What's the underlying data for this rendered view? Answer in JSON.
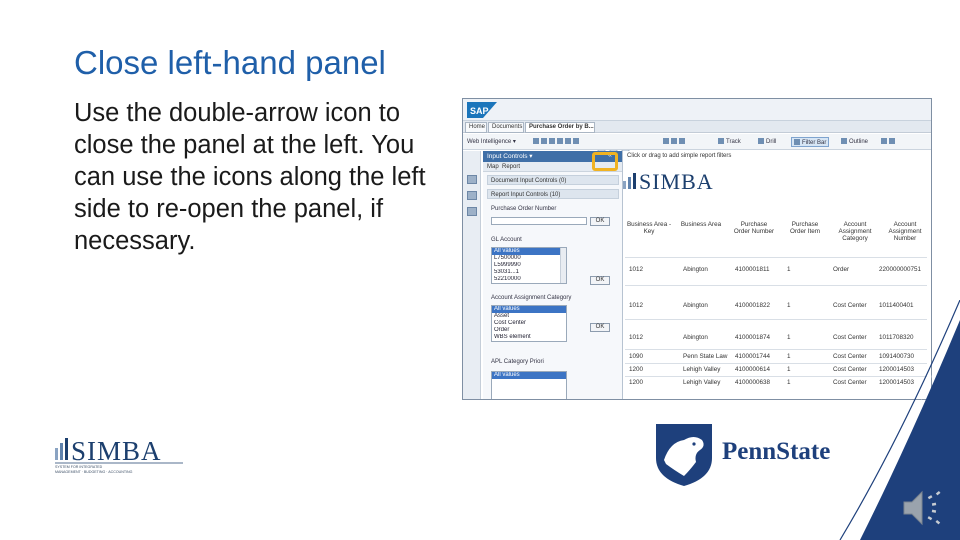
{
  "slide": {
    "title": "Close left-hand panel",
    "body": "Use the double-arrow icon to close the panel at the left. You can use the icons along the left side to re-open the panel, if necessary."
  },
  "screenshot": {
    "tabs": [
      "Home",
      "Documents",
      "Purchase Order by B..."
    ],
    "toolbar": {
      "left_label": "Web Intelligence",
      "track_label": "Track",
      "drill_label": "Drill",
      "filter_bar_label": "Filter Bar",
      "outline_label": "Outline"
    },
    "panel": {
      "header": "Input Controls",
      "map_label": "Map",
      "report_label": "Report",
      "doc_section": "Document Input Controls (0)",
      "report_section": "Report Input Controls (10)",
      "controls": [
        {
          "label": "Purchase Order Number",
          "type": "input",
          "ok": "OK"
        },
        {
          "label": "GL Account",
          "type": "list",
          "ok": "OK",
          "items": [
            "All values",
            "L7500000",
            "L5999990",
            "53031...1",
            "52210000"
          ]
        },
        {
          "label": "Account Assignment Category",
          "type": "list",
          "ok": "OK",
          "items": [
            "All values",
            "Asset",
            "Cost Center",
            "Order",
            "WBS element"
          ]
        },
        {
          "label": "APL Category Priori",
          "type": "list",
          "items": [
            "All values"
          ]
        }
      ],
      "collapse_glyph": "«"
    },
    "report": {
      "tip": "Click or drag to add simple report filters",
      "brand": "SIMBA",
      "headers": [
        "Business Area - Key",
        "Business Area",
        "Purchase Order Number",
        "Purchase Order Item",
        "Account Assignment Category",
        "Account Assignment Number"
      ],
      "rows": [
        [
          "1012",
          "Abington",
          "4100001811",
          "1",
          "Order",
          "220000000751"
        ],
        [
          "1012",
          "Abington",
          "4100001822",
          "1",
          "Cost Center",
          "1011400401"
        ],
        [
          "1012",
          "Abington",
          "4100001874",
          "1",
          "Cost Center",
          "1011708320"
        ],
        [
          "1090",
          "Penn State Law",
          "4100001744",
          "1",
          "Cost Center",
          "1091400730"
        ],
        [
          "1200",
          "Lehigh Valley",
          "4100000614",
          "1",
          "Cost Center",
          "1200014503"
        ],
        [
          "1200",
          "Lehigh Valley",
          "4100000638",
          "1",
          "Cost Center",
          "1200014503"
        ]
      ]
    }
  },
  "footer": {
    "simba_logo": "SIMBA",
    "simba_tagline_1": "SYSTEM FOR INTEGRATED",
    "simba_tagline_2": "MANAGEMENT · BUDGETING · ACCOUNTING",
    "psu_logo": "PennState"
  },
  "colors": {
    "title": "#1f5fa9",
    "simba_blue": "#1c3f6e",
    "psu_navy": "#1e407c",
    "highlight": "#f0b323",
    "panel_header": "#3f6fa7"
  },
  "icons": {
    "collapse": "double-arrow-left-icon",
    "speaker": "speaker-icon"
  }
}
